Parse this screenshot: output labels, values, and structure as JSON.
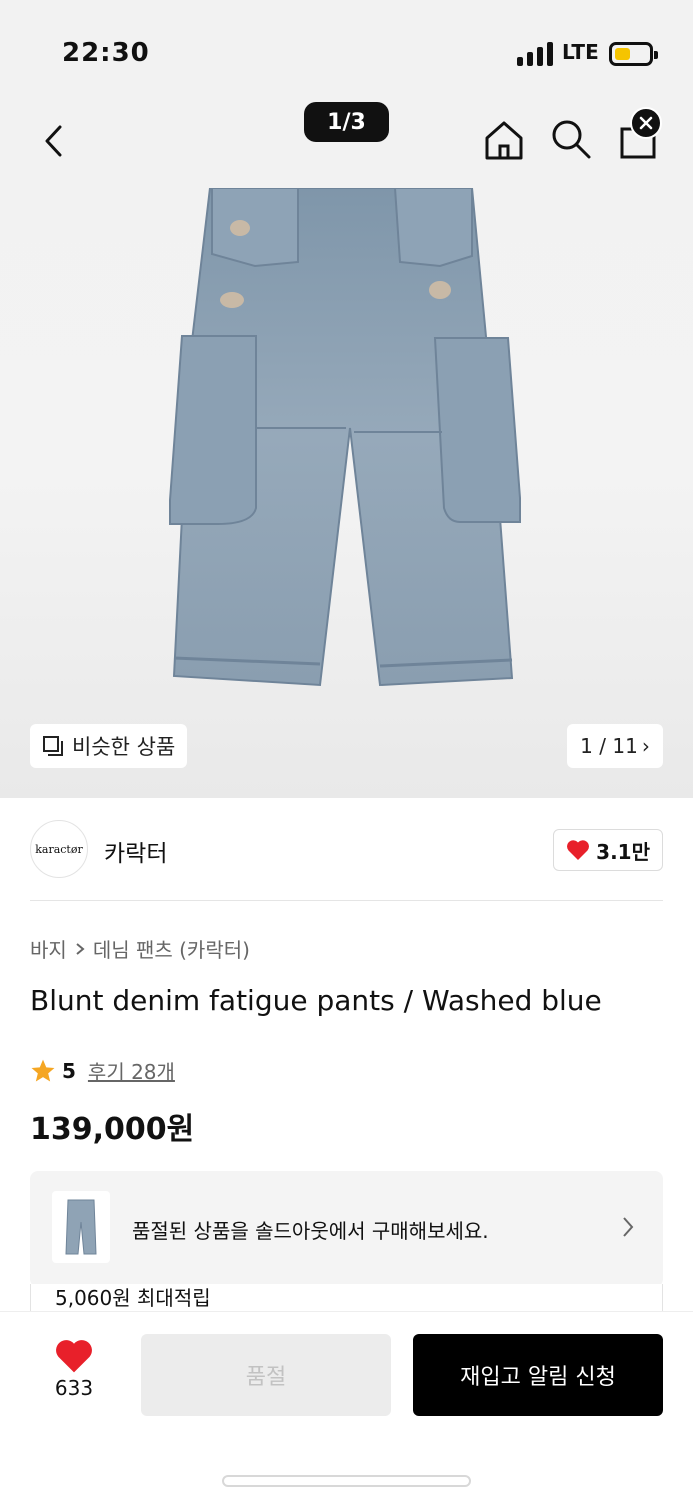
{
  "status_bar": {
    "time": "22:30",
    "network": "LTE",
    "battery_level": 0.4
  },
  "header": {
    "image_counter": "1/3"
  },
  "hero": {
    "similar_label": "비슷한 상품",
    "page_indicator": "1 / 11",
    "chevron": "›"
  },
  "brand": {
    "logo_text": "karactør",
    "name": "카락터",
    "likes": "3.1만"
  },
  "product": {
    "breadcrumb": [
      "바지",
      "데님 팬츠 (카락터)"
    ],
    "title": "Blunt denim fatigue pants / Washed blue",
    "rating": "5",
    "reviews": "후기 28개",
    "price": "139,000원"
  },
  "soldout_banner": {
    "text": "품절된 상품을 솔드아웃에서 구매해보세요."
  },
  "points": {
    "text": "5,060원 최대적립"
  },
  "bottom": {
    "wish_count": "633",
    "soldout_label": "품절",
    "restock_label": "재입고 알림 신청"
  },
  "colors": {
    "accent": "#000000",
    "heart": "#e8202a",
    "star": "#f5a623",
    "denim": "#8fa3b5"
  },
  "icons": [
    "chevron-left-icon",
    "home-icon",
    "search-icon",
    "shopping-bag-icon",
    "close-icon",
    "similar-icon",
    "heart-icon",
    "star-icon",
    "chevron-right-icon"
  ]
}
